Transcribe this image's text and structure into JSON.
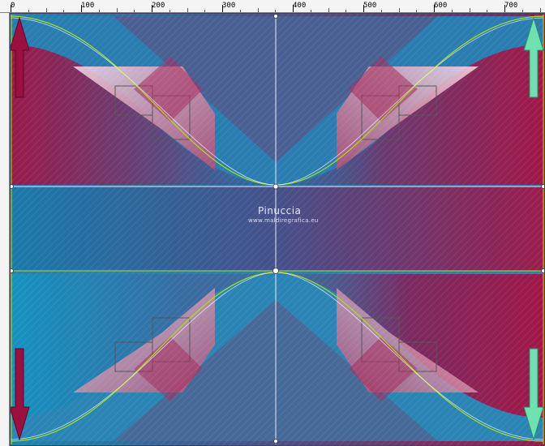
{
  "ruler": {
    "ticks": [
      "0",
      "100",
      "200",
      "300",
      "400",
      "500",
      "600",
      "700"
    ]
  },
  "watermark": {
    "title": "Pinuccia",
    "url": "www.maldiregrafica.eu"
  },
  "colors": {
    "teal": "#1a86b0",
    "crimson": "#9a1a48",
    "mint_arrow": "#6fe0b0",
    "crimson_arrow": "#9a1040",
    "guide_green": "#a8e020",
    "guide_white": "#e8e8ff"
  },
  "icons": {
    "arrows": [
      "up-arrow-crimson-icon",
      "up-arrow-mint-icon",
      "down-arrow-crimson-icon",
      "down-arrow-mint-icon"
    ]
  }
}
